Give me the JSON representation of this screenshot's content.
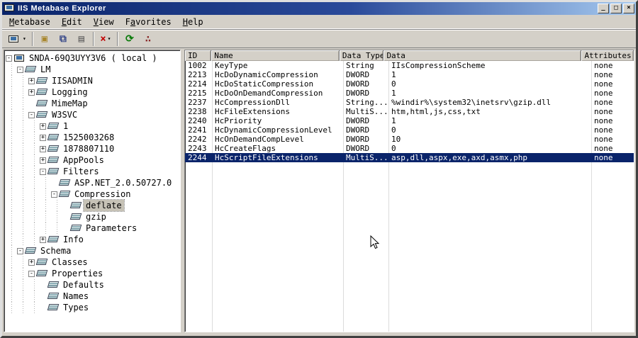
{
  "window": {
    "title": "IIS Metabase Explorer"
  },
  "titlebar_buttons": {
    "minimize": "_",
    "maximize": "□",
    "close": "×"
  },
  "menu": {
    "items": [
      {
        "label": "Metabase",
        "accel": 0
      },
      {
        "label": "Edit",
        "accel": 0
      },
      {
        "label": "View",
        "accel": 0
      },
      {
        "label": "Favorites",
        "accel": 1
      },
      {
        "label": "Help",
        "accel": 0
      }
    ]
  },
  "toolbar": {
    "buttons": [
      {
        "name": "connect-button",
        "icon": "computer-icon",
        "dropdown": true
      },
      {
        "name": "separator"
      },
      {
        "name": "new-key-button",
        "icon": "new-key-icon"
      },
      {
        "name": "copy-key-button",
        "icon": "copy-icon"
      },
      {
        "name": "paste-key-button",
        "icon": "paste-icon"
      },
      {
        "name": "separator"
      },
      {
        "name": "delete-button",
        "icon": "delete-icon",
        "dropdown": true
      },
      {
        "name": "separator"
      },
      {
        "name": "refresh-button",
        "icon": "refresh-icon"
      },
      {
        "name": "network-button",
        "icon": "network-icon"
      }
    ]
  },
  "tree": {
    "items": [
      {
        "label": "SNDA-69Q3UYY3V6 ( local )",
        "depth": 0,
        "expand": "minus",
        "icon": "computer",
        "selected": false
      },
      {
        "label": "LM",
        "depth": 1,
        "expand": "minus",
        "icon": "key",
        "selected": false
      },
      {
        "label": "IISADMIN",
        "depth": 2,
        "expand": "plus",
        "icon": "key",
        "selected": false
      },
      {
        "label": "Logging",
        "depth": 2,
        "expand": "plus",
        "icon": "key",
        "selected": false
      },
      {
        "label": "MimeMap",
        "depth": 2,
        "expand": "none",
        "icon": "key",
        "selected": false
      },
      {
        "label": "W3SVC",
        "depth": 2,
        "expand": "minus",
        "icon": "key",
        "selected": false
      },
      {
        "label": "1",
        "depth": 3,
        "expand": "plus",
        "icon": "key",
        "selected": false
      },
      {
        "label": "1525003268",
        "depth": 3,
        "expand": "plus",
        "icon": "key",
        "selected": false
      },
      {
        "label": "1878807110",
        "depth": 3,
        "expand": "plus",
        "icon": "key",
        "selected": false
      },
      {
        "label": "AppPools",
        "depth": 3,
        "expand": "plus",
        "icon": "key",
        "selected": false
      },
      {
        "label": "Filters",
        "depth": 3,
        "expand": "minus",
        "icon": "key",
        "selected": false
      },
      {
        "label": "ASP.NET_2.0.50727.0",
        "depth": 4,
        "expand": "none",
        "icon": "key",
        "selected": false
      },
      {
        "label": "Compression",
        "depth": 4,
        "expand": "minus",
        "icon": "key",
        "selected": false
      },
      {
        "label": "deflate",
        "depth": 5,
        "expand": "none",
        "icon": "key",
        "selected": true
      },
      {
        "label": "gzip",
        "depth": 5,
        "expand": "none",
        "icon": "key",
        "selected": false
      },
      {
        "label": "Parameters",
        "depth": 5,
        "expand": "none",
        "icon": "key",
        "selected": false
      },
      {
        "label": "Info",
        "depth": 3,
        "expand": "plus",
        "icon": "key",
        "selected": false
      },
      {
        "label": "Schema",
        "depth": 1,
        "expand": "minus",
        "icon": "key",
        "selected": false
      },
      {
        "label": "Classes",
        "depth": 2,
        "expand": "plus",
        "icon": "key",
        "selected": false
      },
      {
        "label": "Properties",
        "depth": 2,
        "expand": "minus",
        "icon": "key",
        "selected": false
      },
      {
        "label": "Defaults",
        "depth": 3,
        "expand": "none",
        "icon": "key",
        "selected": false
      },
      {
        "label": "Names",
        "depth": 3,
        "expand": "none",
        "icon": "key",
        "selected": false
      },
      {
        "label": "Types",
        "depth": 3,
        "expand": "none",
        "icon": "key",
        "selected": false
      }
    ]
  },
  "table": {
    "columns": [
      "ID",
      "Name",
      "Data Type",
      "Data",
      "Attributes"
    ],
    "selected_index": 10,
    "rows": [
      [
        "1002",
        "KeyType",
        "String",
        "IIsCompressionScheme",
        "none"
      ],
      [
        "2213",
        "HcDoDynamicCompression",
        "DWORD",
        "1",
        "none"
      ],
      [
        "2214",
        "HcDoStaticCompression",
        "DWORD",
        "0",
        "none"
      ],
      [
        "2215",
        "HcDoOnDemandCompression",
        "DWORD",
        "1",
        "none"
      ],
      [
        "2237",
        "HcCompressionDll",
        "String...",
        "%windir%\\system32\\inetsrv\\gzip.dll",
        "none"
      ],
      [
        "2238",
        "HcFileExtensions",
        "MultiS...",
        "htm,html,js,css,txt",
        "none"
      ],
      [
        "2240",
        "HcPriority",
        "DWORD",
        "1",
        "none"
      ],
      [
        "2241",
        "HcDynamicCompressionLevel",
        "DWORD",
        "0",
        "none"
      ],
      [
        "2242",
        "HcOnDemandCompLevel",
        "DWORD",
        "10",
        "none"
      ],
      [
        "2243",
        "HcCreateFlags",
        "DWORD",
        "0",
        "none"
      ],
      [
        "2244",
        "HcScriptFileExtensions",
        "MultiS...",
        "asp,dll,aspx,exe,axd,asmx,php",
        "none"
      ]
    ]
  }
}
